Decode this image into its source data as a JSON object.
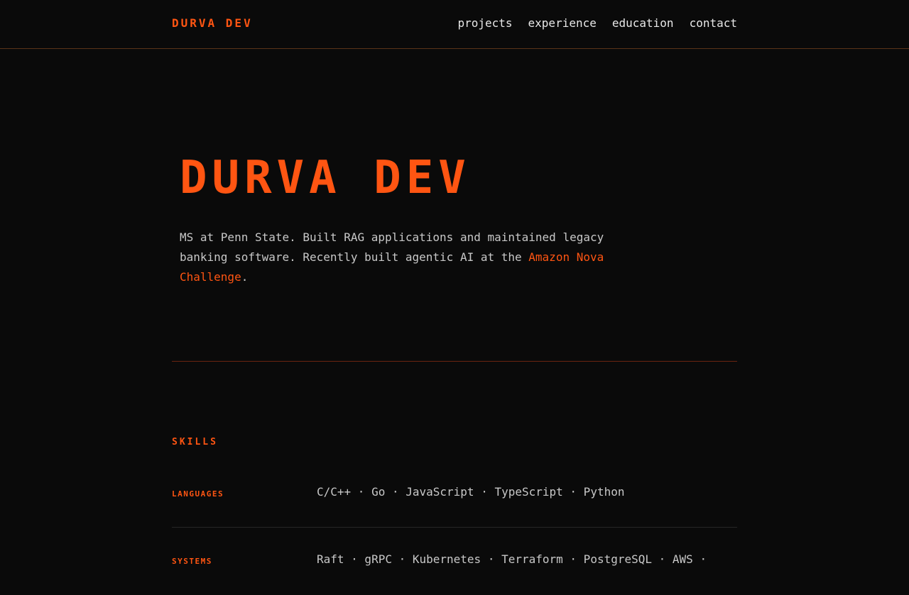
{
  "header": {
    "brand": "DURVA DEV",
    "nav": [
      "projects",
      "experience",
      "education",
      "contact"
    ]
  },
  "hero": {
    "title": "DURVA DEV",
    "intro": "MS at Penn State. Built RAG applications and maintained legacy banking software. Recently built agentic AI at the ",
    "link_text": "Amazon Nova Challenge",
    "outro": "."
  },
  "skills": {
    "heading": "SKILLS",
    "rows": [
      {
        "label": "LANGUAGES",
        "items": "C/C++ · Go · JavaScript · TypeScript · Python"
      },
      {
        "label": "SYSTEMS",
        "items": "Raft · gRPC · Kubernetes · Terraform · PostgreSQL · AWS ·"
      }
    ]
  },
  "colors": {
    "accent": "#ff5512",
    "background": "#0a0a0a",
    "text": "#c8c8c8"
  }
}
